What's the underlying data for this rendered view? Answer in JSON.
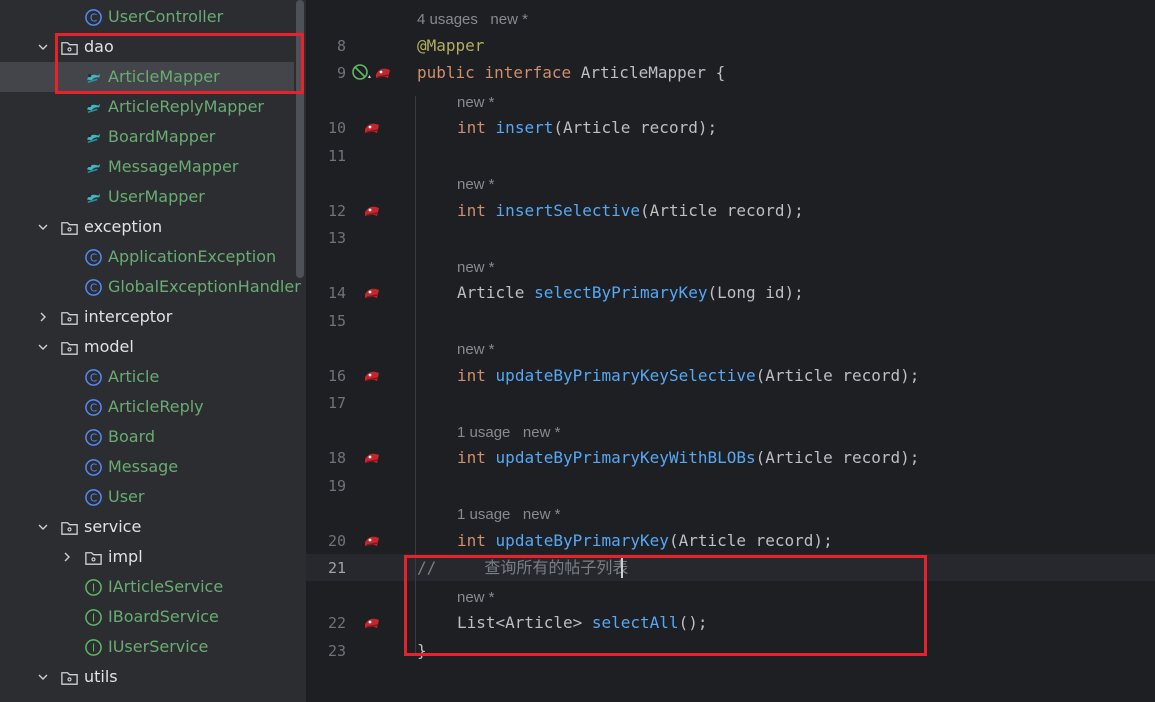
{
  "tree": {
    "items": [
      {
        "label": "UserController",
        "kind": "class"
      },
      {
        "label": "dao",
        "kind": "package"
      },
      {
        "label": "ArticleMapper",
        "kind": "mapper"
      },
      {
        "label": "ArticleReplyMapper",
        "kind": "mapper"
      },
      {
        "label": "BoardMapper",
        "kind": "mapper"
      },
      {
        "label": "MessageMapper",
        "kind": "mapper"
      },
      {
        "label": "UserMapper",
        "kind": "mapper"
      },
      {
        "label": "exception",
        "kind": "package"
      },
      {
        "label": "ApplicationException",
        "kind": "class"
      },
      {
        "label": "GlobalExceptionHandler",
        "kind": "class"
      },
      {
        "label": "interceptor",
        "kind": "package"
      },
      {
        "label": "model",
        "kind": "package"
      },
      {
        "label": "Article",
        "kind": "class"
      },
      {
        "label": "ArticleReply",
        "kind": "class"
      },
      {
        "label": "Board",
        "kind": "class"
      },
      {
        "label": "Message",
        "kind": "class"
      },
      {
        "label": "User",
        "kind": "class"
      },
      {
        "label": "service",
        "kind": "package"
      },
      {
        "label": "impl",
        "kind": "package"
      },
      {
        "label": "IArticleService",
        "kind": "interface"
      },
      {
        "label": "IBoardService",
        "kind": "interface"
      },
      {
        "label": "IUserService",
        "kind": "interface"
      },
      {
        "label": "utils",
        "kind": "package"
      }
    ]
  },
  "editor": {
    "hint_usages_4": "4 usages",
    "hint_new": "new *",
    "hint_usage_1": "1 usage",
    "lines": {
      "l8": "8",
      "l9": "9",
      "l10": "10",
      "l11": "11",
      "l12": "12",
      "l13": "13",
      "l14": "14",
      "l15": "15",
      "l16": "16",
      "l17": "17",
      "l18": "18",
      "l19": "19",
      "l20": "20",
      "l21": "21",
      "l22": "22",
      "l23": "23"
    },
    "code": {
      "annotation": "@Mapper",
      "kw_public": "public",
      "kw_interface": "interface",
      "class_name": " ArticleMapper {",
      "kw_int": "int",
      "m_insert": "insert",
      "p_insert": "(Article record);",
      "m_insertSelective": "insertSelective",
      "p_insertSelective": "(Article record);",
      "t_article": "Article ",
      "m_selectByPrimaryKey": "selectByPrimaryKey",
      "p_selectByPrimaryKey": "(Long id);",
      "m_updSel": "updateByPrimaryKeySelective",
      "p_updSel": "(Article record);",
      "m_updBlobs": "updateByPrimaryKeyWithBLOBs",
      "p_updBlobs": "(Article record);",
      "m_upd": "updateByPrimaryKey",
      "p_upd": "(Article record);",
      "comment": "//     查询所有的帖子列表",
      "t_list": "List<Article> ",
      "m_selectAll": "selectAll",
      "p_selectAll": "();",
      "close_brace": "}"
    }
  },
  "colors": {
    "highlight_box": "#e5232c",
    "class_label": "#6aab73",
    "method": "#56a8f5",
    "keyword": "#cf8e6d"
  }
}
